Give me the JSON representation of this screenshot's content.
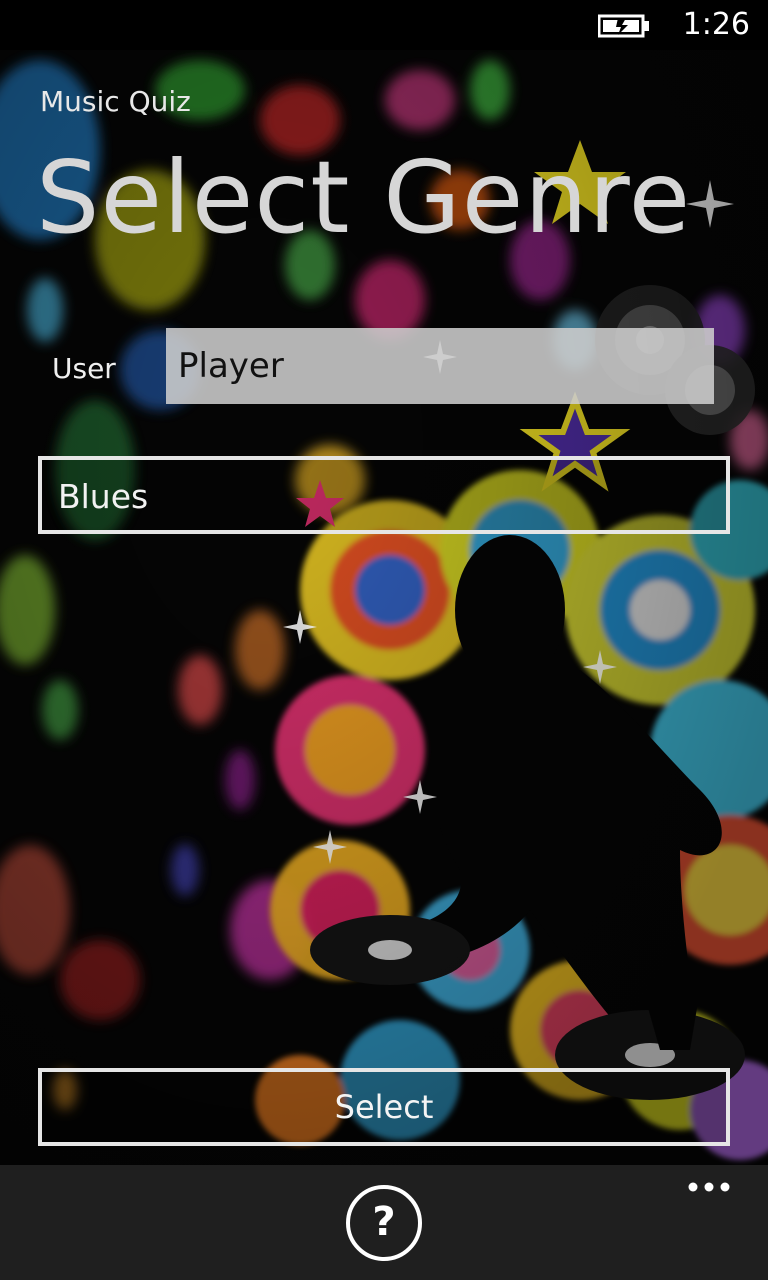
{
  "status_bar": {
    "time": "1:26",
    "battery_icon": "battery-charging-icon"
  },
  "header": {
    "app_title": "Music Quiz",
    "page_title": "Select Genre"
  },
  "form": {
    "user_label": "User",
    "user_value": "Player",
    "genre_selected": "Blues",
    "select_button_label": "Select"
  },
  "app_bar": {
    "help_icon": "question-circle-icon",
    "more_icon": "ellipsis-icon",
    "help_glyph": "?"
  },
  "colors": {
    "background": "#000000",
    "app_bar": "#1f1f1f",
    "text": "#ffffff",
    "input_fill": "#cdcdcd"
  }
}
